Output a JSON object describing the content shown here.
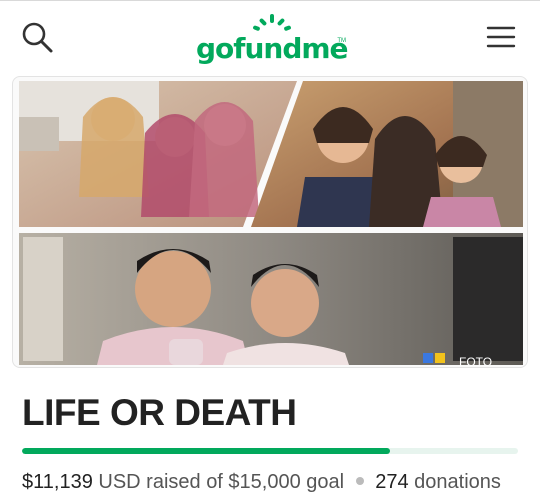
{
  "header": {
    "logo_text": "gofundme",
    "logo_tm": "TM",
    "brand_color": "#02a95c",
    "search_icon": "search-icon",
    "menu_icon": "hamburger-menu-icon"
  },
  "campaign": {
    "title": "LIFE OR DEATH",
    "photo_watermark": "FOTO",
    "progress_fraction": 0.7426,
    "raised_amount": "$11,139",
    "raised_suffix": "USD raised of $15,000 goal",
    "donations_count": "274",
    "donations_label": "donations"
  }
}
